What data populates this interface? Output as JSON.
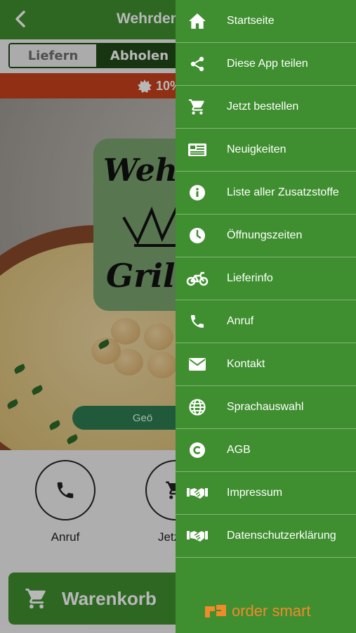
{
  "header": {
    "title": "Wehrdene"
  },
  "order_mode": {
    "delivery_label": "Liefern",
    "pickup_label": "Abholen",
    "selected": "Abholen"
  },
  "promo": {
    "text": "10%"
  },
  "logo": {
    "line1": "Weh",
    "line2": "Gril"
  },
  "status_pill": {
    "text": "Geö"
  },
  "actions": [
    {
      "label": "Anruf",
      "icon": "phone-icon"
    },
    {
      "label": "Jetzt b",
      "icon": "cart-icon"
    }
  ],
  "cart_button": {
    "label": "Warenkorb",
    "icon": "cart-icon"
  },
  "menu": {
    "items": [
      {
        "label": "Startseite",
        "icon": "home-icon"
      },
      {
        "label": "Diese App teilen",
        "icon": "share-icon"
      },
      {
        "label": "Jetzt bestellen",
        "icon": "cart-icon"
      },
      {
        "label": "Neuigkeiten",
        "icon": "news-icon"
      },
      {
        "label": "Liste aller Zusatzstoffe",
        "icon": "info-icon"
      },
      {
        "label": "Öffnungszeiten",
        "icon": "clock-icon"
      },
      {
        "label": "Lieferinfo",
        "icon": "motorbike-icon"
      },
      {
        "label": "Anruf",
        "icon": "phone-icon"
      },
      {
        "label": "Kontakt",
        "icon": "envelope-icon"
      },
      {
        "label": "Sprachauswahl",
        "icon": "globe-icon"
      },
      {
        "label": "AGB",
        "icon": "copyright-icon"
      },
      {
        "label": "Impressum",
        "icon": "handshake-icon"
      },
      {
        "label": "Datenschutzerklärung",
        "icon": "handshake-icon"
      }
    ]
  },
  "brand": {
    "text": "order smart"
  },
  "colors": {
    "primary_green": "#3f8f30",
    "dark_green": "#1f4a17",
    "promo_orange": "#c8421d",
    "brand_orange": "#f08a2b"
  }
}
